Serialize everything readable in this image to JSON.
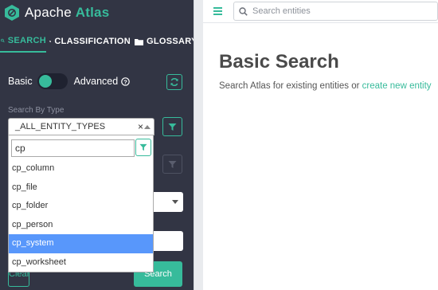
{
  "app": {
    "name_part1": "Apache",
    "name_part2": "Atlas"
  },
  "tabs": [
    {
      "label": "SEARCH",
      "icon": "search-icon",
      "active": true
    },
    {
      "label": "CLASSIFICATION",
      "icon": "tag-icon",
      "active": false
    },
    {
      "label": "GLOSSARY",
      "icon": "folder-icon",
      "active": false
    }
  ],
  "toggle": {
    "basic_label": "Basic",
    "advanced_label": "Advanced",
    "mode": "basic"
  },
  "search_by_type": {
    "label": "Search By Type",
    "selected": "_ALL_ENTITY_TYPES",
    "clear_symbol": "×",
    "dropdown": {
      "query": "cp",
      "options": [
        "cp_column",
        "cp_file",
        "cp_folder",
        "cp_person",
        "cp_system",
        "cp_worksheet"
      ],
      "highlighted_index": 4
    }
  },
  "buttons": {
    "clear": "Clear",
    "search": "Search"
  },
  "topbar": {
    "search_placeholder": "Search entities"
  },
  "main": {
    "title": "Basic Search",
    "subtitle_prefix": "Search Atlas for existing entities or",
    "subtitle_link": "create new entity"
  },
  "colors": {
    "accent": "#37bb9b",
    "sidebar_bg": "#323544",
    "highlight": "#5897fb"
  }
}
